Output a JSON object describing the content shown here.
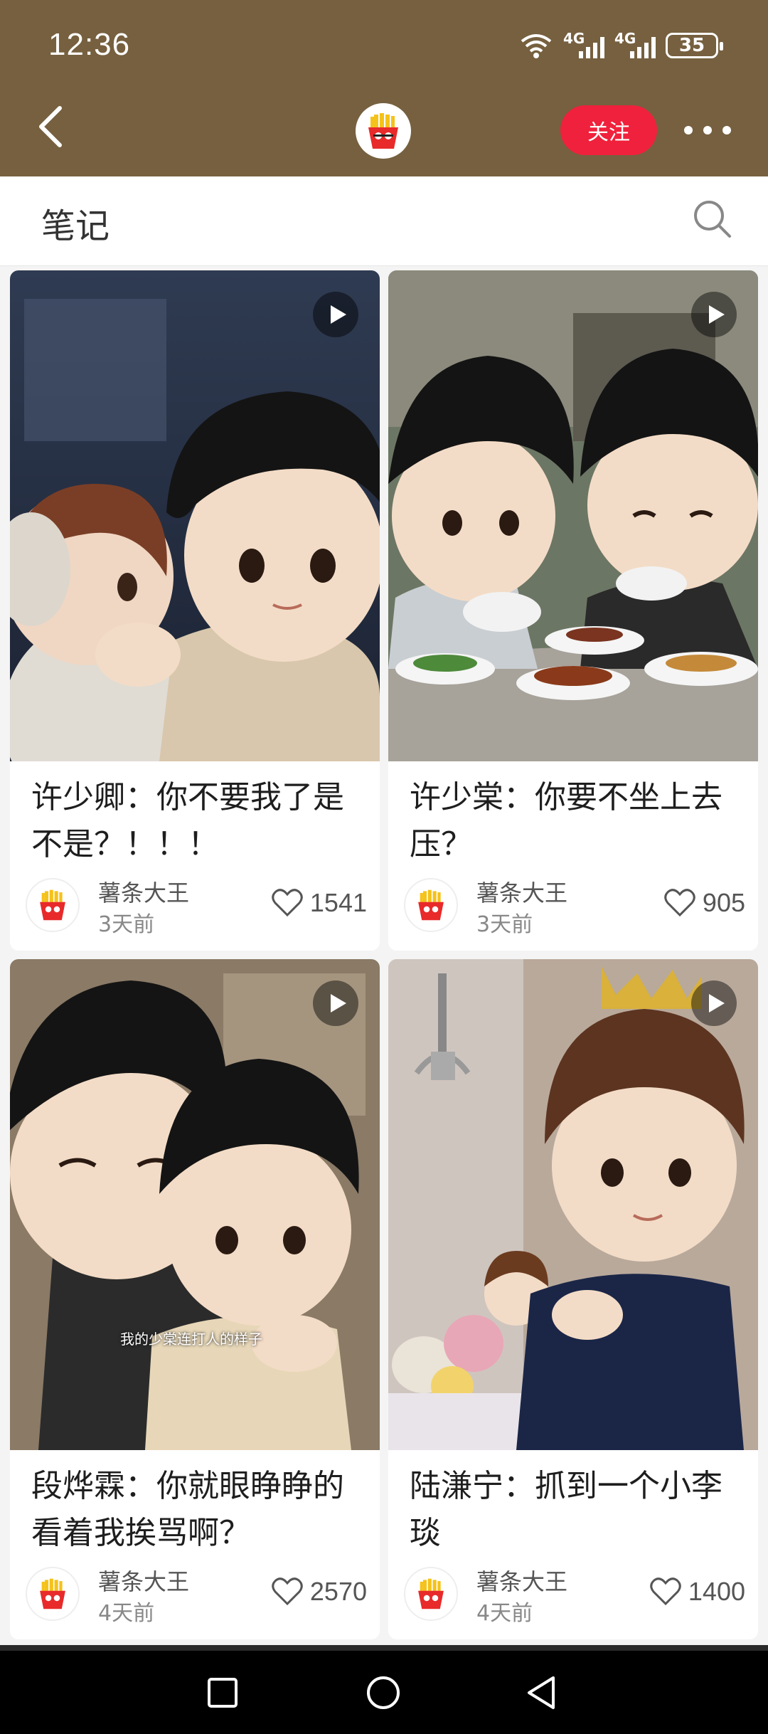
{
  "status_bar": {
    "time": "12:36",
    "signal_1": "4G",
    "signal_2": "4G",
    "battery": "35"
  },
  "header": {
    "follow_label": "关注"
  },
  "section": {
    "title": "笔记"
  },
  "cards": [
    {
      "title": "许少卿：你不要我了是不是？！！！",
      "author": "薯条大王",
      "time": "3天前",
      "likes": "1541",
      "is_video": true
    },
    {
      "title": "许少棠：你要不坐上去压？",
      "author": "薯条大王",
      "time": "3天前",
      "likes": "905",
      "is_video": true
    },
    {
      "title": "段烨霖：你就眼睁睁的看着我挨骂啊？",
      "author": "薯条大王",
      "time": "4天前",
      "likes": "2570",
      "is_video": true,
      "caption": "我的少棠连打人的样子"
    },
    {
      "title": "陆溓宁：抓到一个小李琰",
      "author": "薯条大王",
      "time": "4天前",
      "likes": "1400",
      "is_video": true
    }
  ],
  "colors": {
    "header_bg": "#76603f",
    "follow_button": "#f0213c",
    "logo_bg": "#e82a2a",
    "fries": "#f5c21a"
  }
}
